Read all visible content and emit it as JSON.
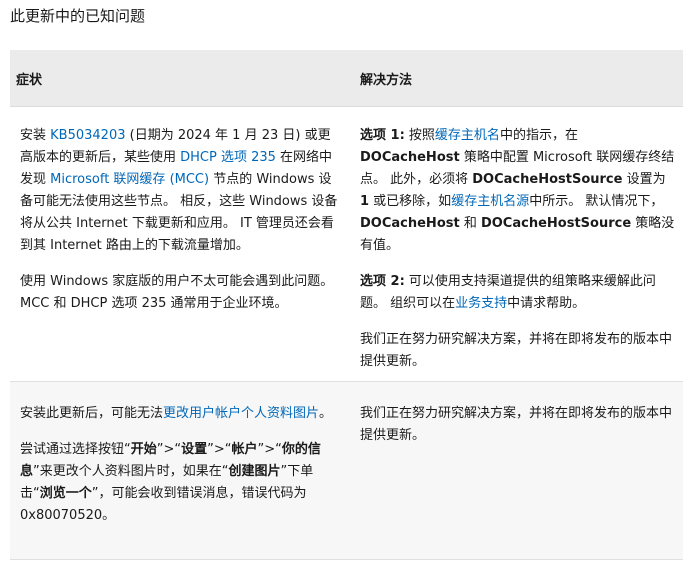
{
  "title": "此更新中的已知问题",
  "table": {
    "headers": {
      "symptom": "症状",
      "resolution": "解决方法"
    },
    "row1": {
      "symptom_p1": {
        "a": "安装 ",
        "kb_link": "KB5034203",
        "b": " (日期为 2024 年 1 月 23 日) 或更高版本的更新后，某些使用 ",
        "dhcp_link": "DHCP 选项 235",
        "c": " 在网络中发现 ",
        "mcc_link": "Microsoft 联网缓存 (MCC)",
        "d": " 节点的 Windows 设备可能无法使用这些节点。 相反，这些 Windows 设备将从公共 Internet 下载更新和应用。 IT 管理员还会看到其 Internet 路由上的下载流量增加。"
      },
      "symptom_p2": "使用 Windows 家庭版的用户不太可能会遇到此问题。 MCC 和 DHCP 选项 235 通常用于企业环境。",
      "resolution_p1": {
        "label": "选项 1:",
        "a": " 按照",
        "hostname_link": "缓存主机名",
        "b": "中的指示，在 ",
        "docachehost": "DOCacheHost",
        "c": " 策略中配置 Microsoft 联网缓存终结点。 此外，必须将 ",
        "docachehostsource": "DOCacheHostSource",
        "d": " 设置为 ",
        "one": "1",
        "e": " 或已移除，如",
        "hostsource_link": "缓存主机名源",
        "f": "中所示。 默认情况下，",
        "docachehost2": "DOCacheHost",
        "g": " 和 ",
        "docachehostsource2": "DOCacheHostSource",
        "h": " 策略没有值。"
      },
      "resolution_p2": {
        "label": "选项 2:",
        "a": " 可以使用支持渠道提供的组策略来缓解此问题。 组织可以在",
        "support_link": "业务支持",
        "b": "中请求帮助。"
      },
      "resolution_p3": "我们正在努力研究解决方案，并将在即将发布的版本中提供更新。"
    },
    "row2": {
      "symptom_p1": {
        "a": "安装此更新后，可能无法",
        "pic_link": "更改用户帐户个人资料图片",
        "b": "。"
      },
      "symptom_p2": {
        "a": "尝试通过选择按钮“",
        "start": "开始",
        "b": "”>“",
        "settings": "设置",
        "c": "”>“",
        "accounts": "帐户",
        "d": "”>“",
        "yourinfo": "你的信息",
        "e": "”来更改个人资料图片时，如果在“",
        "createpic": "创建图片",
        "f": "”下单击“",
        "browse": "浏览一个",
        "g": "”，可能会收到错误消息，错误代码为 0x80070520。"
      },
      "resolution_p1": "我们正在努力研究解决方案，并将在即将发布的版本中提供更新。"
    }
  }
}
